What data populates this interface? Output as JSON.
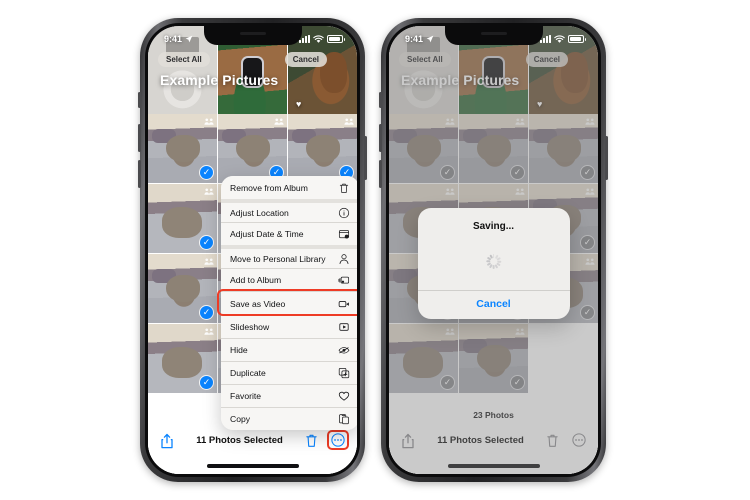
{
  "status_bar": {
    "time": "9:41",
    "location_icon": "location-arrow-icon",
    "cellular_icon": "cellular-bars-icon",
    "wifi_icon": "wifi-icon",
    "battery_icon": "battery-icon"
  },
  "album": {
    "title": "Example Pictures",
    "select_all_label": "Select All",
    "cancel_label": "Cancel",
    "photo_count": "23 Photos"
  },
  "toolbar": {
    "share_icon": "share-icon",
    "selection_label": "11 Photos Selected",
    "trash_icon": "trash-icon",
    "more_icon": "ellipsis-circle-icon"
  },
  "context_menu": {
    "items": [
      {
        "label": "Remove from Album",
        "icon": "trash-icon",
        "group": 0
      },
      {
        "label": "Adjust Location",
        "icon": "location-info-icon",
        "group": 1
      },
      {
        "label": "Adjust Date & Time",
        "icon": "calendar-clock-icon",
        "group": 1
      },
      {
        "label": "Move to Personal Library",
        "icon": "person-icon",
        "group": 2
      },
      {
        "label": "Add to Album",
        "icon": "album-add-icon",
        "group": 2
      },
      {
        "label": "Save as Video",
        "icon": "video-camera-icon",
        "group": 2
      },
      {
        "label": "Slideshow",
        "icon": "play-box-icon",
        "group": 2
      },
      {
        "label": "Hide",
        "icon": "eye-slash-icon",
        "group": 2
      },
      {
        "label": "Duplicate",
        "icon": "duplicate-icon",
        "group": 2
      },
      {
        "label": "Favorite",
        "icon": "heart-icon",
        "group": 2
      },
      {
        "label": "Copy",
        "icon": "copy-icon",
        "group": 2
      }
    ],
    "highlighted_item": "Save as Video"
  },
  "alert": {
    "title": "Saving...",
    "cancel_label": "Cancel",
    "spinner_icon": "activity-spinner-icon"
  },
  "colors": {
    "accent_blue": "#0a84ff",
    "highlight_red": "#ee3b25",
    "menu_bg": "#f7f6f4",
    "muted_gray": "#8e8e93"
  },
  "grid": {
    "hero": [
      {
        "art": "ph-ipod",
        "name": "photo-ipod"
      },
      {
        "art": "ph-watch",
        "name": "photo-apple-watch"
      },
      {
        "art": "ph-dog",
        "name": "photo-dog"
      }
    ],
    "left_tiles": [
      1,
      2,
      3,
      4,
      5,
      6,
      7,
      8,
      9,
      10,
      11,
      12
    ],
    "right_tiles": [
      1,
      2,
      3,
      4,
      5,
      6,
      7,
      8,
      9,
      10,
      11
    ]
  }
}
